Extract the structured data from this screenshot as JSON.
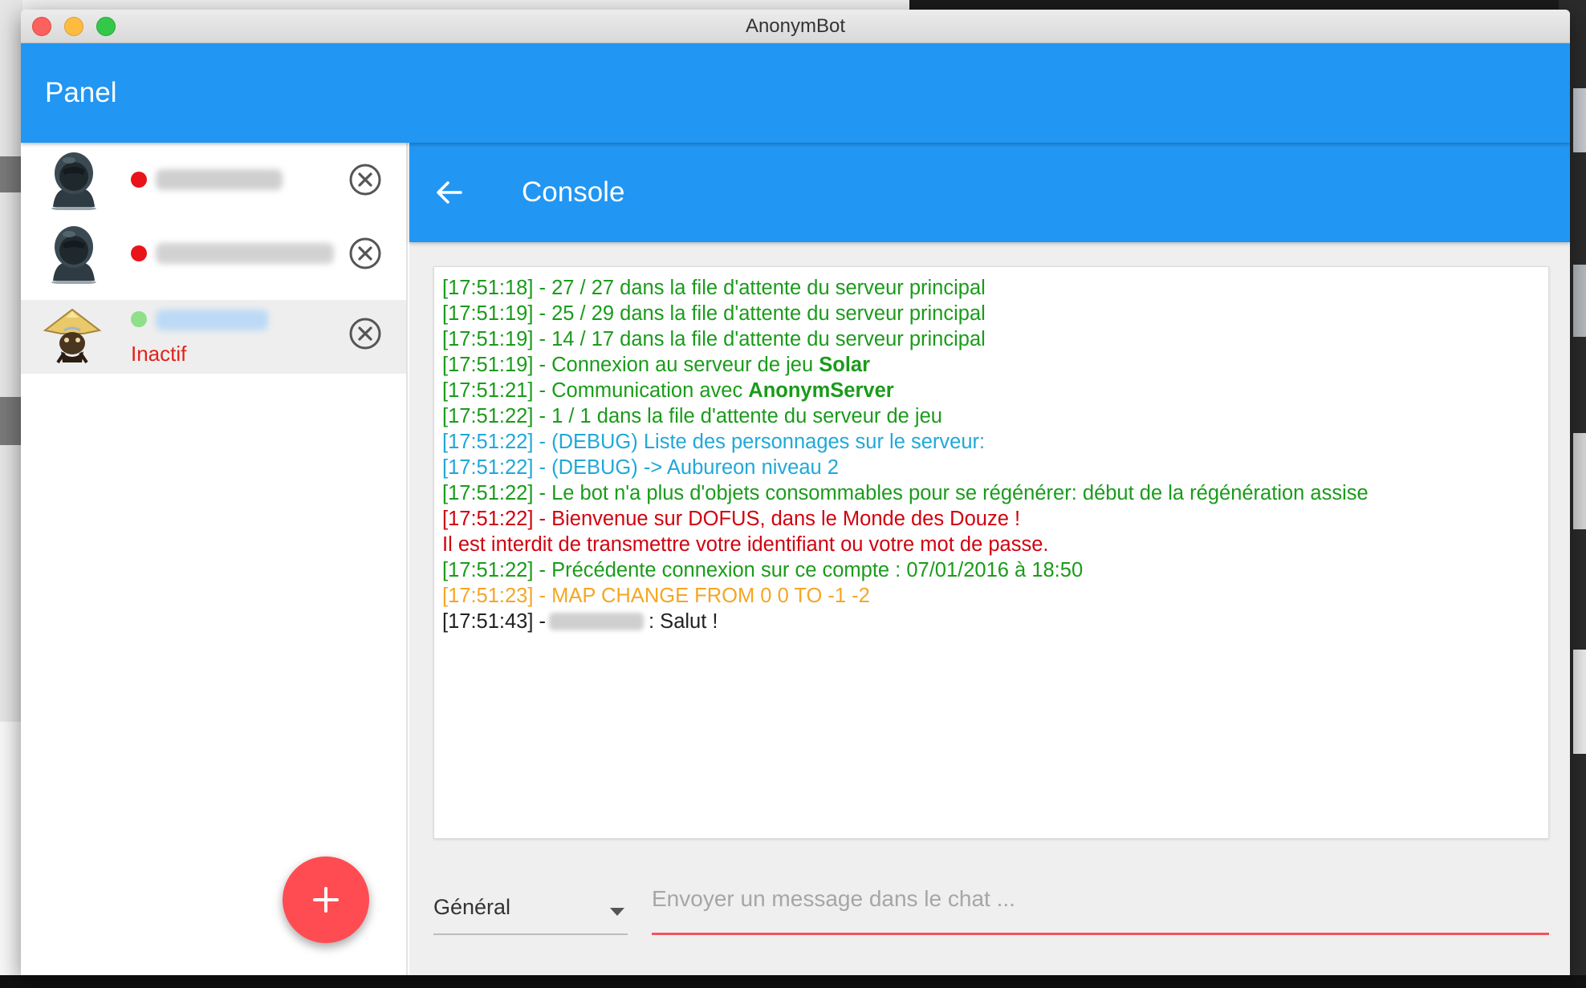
{
  "window": {
    "title": "AnonymBot"
  },
  "appbar": {
    "title": "Panel"
  },
  "sidebar": {
    "accounts": [
      {
        "status_color": "#e8141a",
        "status_text": "",
        "avatar_icon": "dark-mask-avatar-icon"
      },
      {
        "status_color": "#e8141a",
        "status_text": "",
        "avatar_icon": "dark-mask-avatar-icon"
      },
      {
        "status_color": "#8ee08a",
        "status_text": "Inactif",
        "avatar_icon": "character-avatar-icon",
        "selected": true
      }
    ],
    "add_button_icon": "plus-icon"
  },
  "console_pane": {
    "title": "Console",
    "back_icon": "arrow-left-icon",
    "log": [
      {
        "color": "green",
        "text": "[17:51:18] - 27 / 27 dans la file d'attente du serveur principal"
      },
      {
        "color": "green",
        "text": "[17:51:19] - 25 / 29 dans la file d'attente du serveur principal"
      },
      {
        "color": "green",
        "text": "[17:51:19] - 14 / 17 dans la file d'attente du serveur principal"
      },
      {
        "color": "green",
        "text": "[17:51:19] - Connexion au serveur de jeu ",
        "bold": "Solar"
      },
      {
        "color": "green",
        "text": "[17:51:21] - Communication avec ",
        "bold": "AnonymServer"
      },
      {
        "color": "green",
        "text": "[17:51:22] - 1 / 1 dans la file d'attente du serveur de jeu"
      },
      {
        "color": "blue",
        "text": "[17:51:22] - (DEBUG) Liste des personnages sur le serveur:"
      },
      {
        "color": "blue",
        "text": "[17:51:22] - (DEBUG) -> Aubureon niveau 2"
      },
      {
        "color": "green",
        "text": "[17:51:22] - Le bot n'a plus d'objets consommables pour se régénérer: début de la régénération assise"
      },
      {
        "color": "red",
        "text": "[17:51:22] - Bienvenue sur DOFUS, dans le Monde des Douze !"
      },
      {
        "color": "red",
        "text": "Il est interdit de transmettre votre identifiant ou votre mot de passe."
      },
      {
        "color": "green",
        "text": "[17:51:22] - Précédente connexion sur ce compte : 07/01/2016 à 18:50"
      },
      {
        "color": "orange",
        "text": "[17:51:23] - MAP CHANGE FROM 0 0 TO -1 -2"
      },
      {
        "color": "black",
        "prefix": "[17:51:43] -",
        "suffix": ": Salut !"
      }
    ],
    "channel": {
      "selected": "Général"
    },
    "chat": {
      "placeholder": "Envoyer un message dans le chat ..."
    }
  },
  "colors": {
    "primary": "#2196f3",
    "fab": "#ff4c53",
    "log_green": "#1a9b1a",
    "log_blue": "#20a8d8",
    "log_red": "#d0020f",
    "log_orange": "#f5a623"
  }
}
